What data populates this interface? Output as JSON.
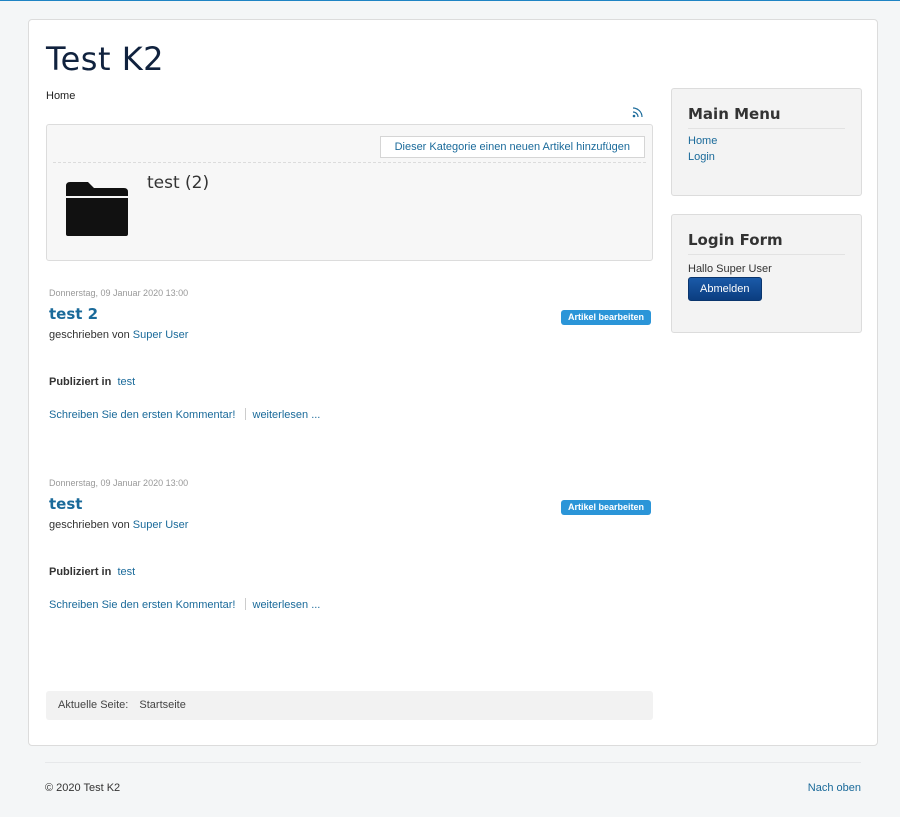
{
  "site": {
    "title": "Test K2"
  },
  "breadcrumb": {
    "label": "Home"
  },
  "category": {
    "add_article_label": "Dieser Kategorie einen neuen Artikel hinzufügen",
    "title": "test (2)"
  },
  "items": [
    {
      "date": "Donnerstag, 09 Januar 2020 13:00",
      "title": "test 2",
      "edit_label": "Artikel bearbeiten",
      "author_prefix": "geschrieben von",
      "author": "Super User",
      "published_label": "Publiziert in",
      "category": "test",
      "comment_link": "Schreiben Sie den ersten Kommentar!",
      "read_more": "weiterlesen ..."
    },
    {
      "date": "Donnerstag, 09 Januar 2020 13:00",
      "title": "test",
      "edit_label": "Artikel bearbeiten",
      "author_prefix": "geschrieben von",
      "author": "Super User",
      "published_label": "Publiziert in",
      "category": "test",
      "comment_link": "Schreiben Sie den ersten Kommentar!",
      "read_more": "weiterlesen ..."
    }
  ],
  "pagination": {
    "label": "Aktuelle Seite:",
    "value": "Startseite"
  },
  "main_menu": {
    "title": "Main Menu",
    "items": [
      {
        "label": "Home"
      },
      {
        "label": "Login"
      }
    ]
  },
  "login_form": {
    "title": "Login Form",
    "greeting": "Hallo Super User",
    "logout_label": "Abmelden"
  },
  "footer": {
    "copyright": "© 2020 Test K2",
    "to_top": "Nach oben"
  },
  "icons": {
    "rss": "rss-feed-icon",
    "folder": "folder-icon"
  },
  "colors": {
    "link": "#1a6a9a",
    "badge": "#2b95d8",
    "button": "#0b3d80",
    "title": "#10223e"
  }
}
